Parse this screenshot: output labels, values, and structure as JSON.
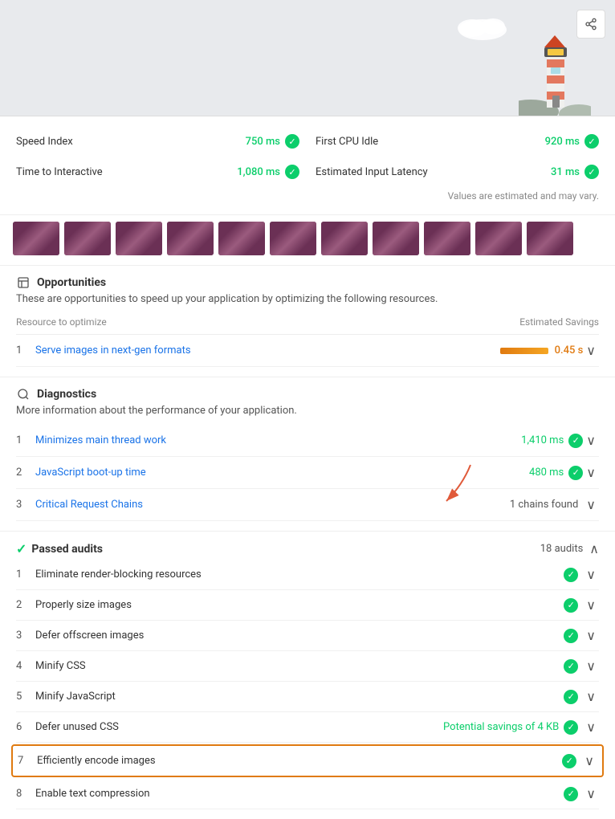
{
  "header": {
    "share_label": "⎋"
  },
  "metrics": {
    "items": [
      {
        "label": "Speed Index",
        "value": "750 ms",
        "status": "good"
      },
      {
        "label": "First CPU Idle",
        "value": "920 ms",
        "status": "good"
      },
      {
        "label": "Time to Interactive",
        "value": "1,080 ms",
        "status": "good"
      },
      {
        "label": "Estimated Input Latency",
        "value": "31 ms",
        "status": "good"
      }
    ],
    "note": "Values are estimated and may vary."
  },
  "opportunities": {
    "section_icon": "📋",
    "section_title": "Opportunities",
    "section_desc": "These are opportunities to speed up your application by optimizing the following resources.",
    "col_resource": "Resource to optimize",
    "col_savings": "Estimated Savings",
    "items": [
      {
        "number": "1",
        "label": "Serve images in next-gen formats",
        "savings": "0.45 s",
        "has_bar": true
      }
    ]
  },
  "diagnostics": {
    "section_icon": "🔍",
    "section_title": "Diagnostics",
    "section_desc": "More information about the performance of your application.",
    "items": [
      {
        "number": "1",
        "label": "Minimizes main thread work",
        "value": "1,410 ms",
        "type": "green"
      },
      {
        "number": "2",
        "label": "JavaScript boot-up time",
        "value": "480 ms",
        "type": "green"
      },
      {
        "number": "3",
        "label": "Critical Request Chains",
        "value": "1 chains found",
        "type": "neutral"
      }
    ]
  },
  "passed_audits": {
    "section_title": "Passed audits",
    "count": "18 audits",
    "items": [
      {
        "number": "1",
        "label": "Eliminate render-blocking resources",
        "value": "",
        "highlighted": false
      },
      {
        "number": "2",
        "label": "Properly size images",
        "value": "",
        "highlighted": false
      },
      {
        "number": "3",
        "label": "Defer offscreen images",
        "value": "",
        "highlighted": false
      },
      {
        "number": "4",
        "label": "Minify CSS",
        "value": "",
        "highlighted": false
      },
      {
        "number": "5",
        "label": "Minify JavaScript",
        "value": "",
        "highlighted": false
      },
      {
        "number": "6",
        "label": "Defer unused CSS",
        "value": "Potential savings of 4 KB",
        "highlighted": false
      },
      {
        "number": "7",
        "label": "Efficiently encode images",
        "value": "",
        "highlighted": true
      },
      {
        "number": "8",
        "label": "Enable text compression",
        "value": "",
        "highlighted": false
      }
    ]
  }
}
